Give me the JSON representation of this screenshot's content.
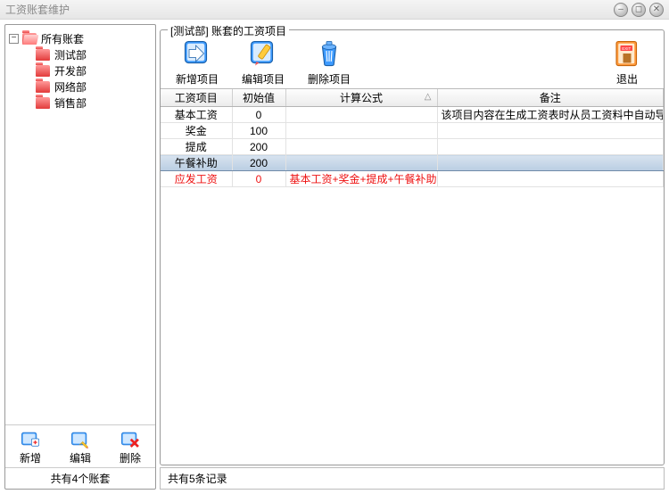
{
  "window": {
    "title": "工资账套维护"
  },
  "tree": {
    "root_label": "所有账套",
    "items": [
      {
        "label": "测试部"
      },
      {
        "label": "开发部"
      },
      {
        "label": "网络部"
      },
      {
        "label": "销售部"
      }
    ]
  },
  "left_toolbar": {
    "add": "新增",
    "edit": "编辑",
    "delete": "删除"
  },
  "left_status": "共有4个账套",
  "group_legend": "[测试部] 账套的工资项目",
  "main_toolbar": {
    "add_item": "新增项目",
    "edit_item": "编辑项目",
    "delete_item": "删除项目",
    "exit": "退出"
  },
  "table": {
    "columns": [
      "工资项目",
      "初始值",
      "计算公式",
      "备注"
    ],
    "rows": [
      {
        "name": "基本工资",
        "init": "0",
        "formula": "",
        "remark": "该项目内容在生成工资表时从员工资料中自动导入",
        "selected": false,
        "red": false
      },
      {
        "name": "奖金",
        "init": "100",
        "formula": "",
        "remark": "",
        "selected": false,
        "red": false
      },
      {
        "name": "提成",
        "init": "200",
        "formula": "",
        "remark": "",
        "selected": false,
        "red": false
      },
      {
        "name": "午餐补助",
        "init": "200",
        "formula": "",
        "remark": "",
        "selected": true,
        "red": false
      },
      {
        "name": "应发工资",
        "init": "0",
        "formula": "基本工资+奖金+提成+午餐补助",
        "remark": "",
        "selected": false,
        "red": true
      }
    ]
  },
  "right_status": "共有5条记录"
}
